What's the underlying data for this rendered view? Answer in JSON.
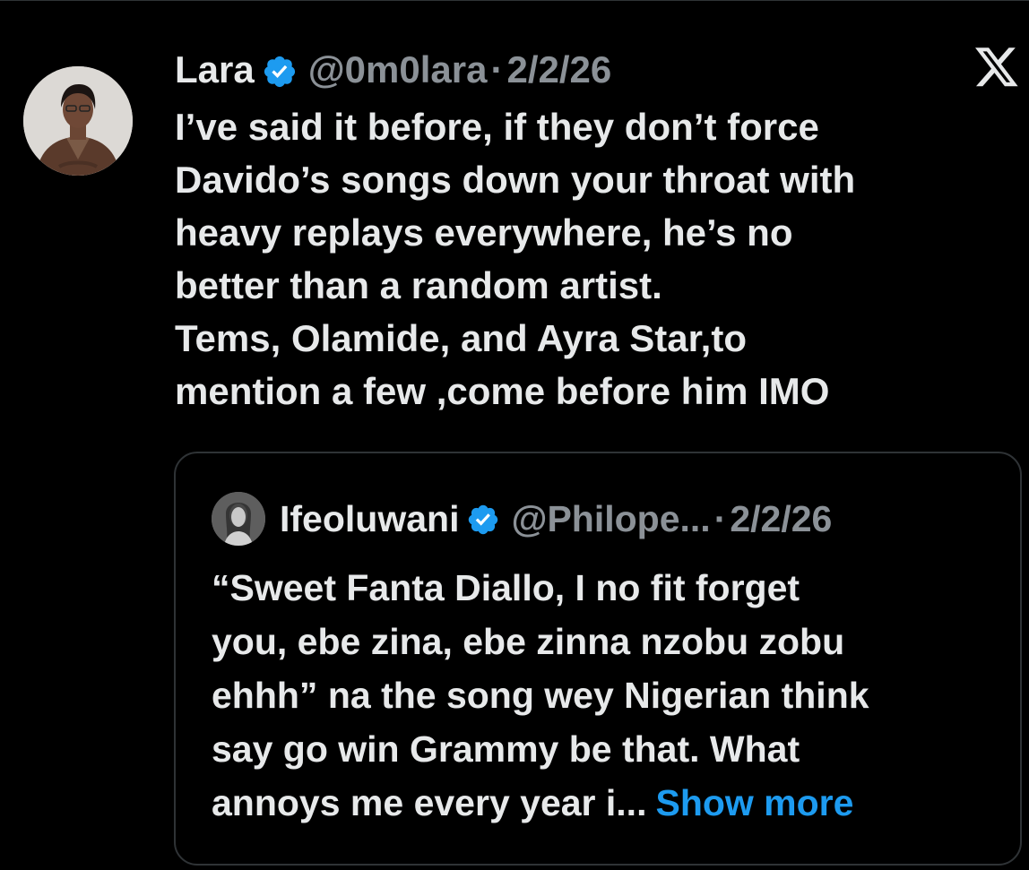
{
  "tweet": {
    "author": {
      "name": "Lara",
      "handle": "@0m0lara",
      "verified": true
    },
    "separator": "·",
    "date": "2/2/26",
    "text_lines": [
      "I’ve said it before, if they don’t force",
      "Davido’s songs down your throat with",
      "heavy replays everywhere, he’s no",
      "better than a random artist.",
      "Tems, Olamide, and Ayra Star,to",
      "mention a few ,come before him IMO"
    ]
  },
  "quoted_tweet": {
    "author": {
      "name": "Ifeoluwani",
      "handle": "@Philope...",
      "verified": true
    },
    "separator": "·",
    "date": "2/2/26",
    "text_lines": [
      "“Sweet Fanta Diallo, I no fit forget",
      "you, ebe zina, ebe zinna nzobu zobu",
      "ehhh” na the song wey Nigerian think",
      "say go win Grammy be that. What",
      "annoys me every year i..."
    ],
    "show_more_label": "Show more"
  },
  "icons": {
    "platform_logo": "x-logo-icon",
    "verified_badge": "verified-badge-icon"
  },
  "colors": {
    "background": "#000000",
    "text": "#e7e9ea",
    "secondary_text": "#8b9197",
    "link": "#1d9bf0",
    "verified": "#1d9bf0",
    "border": "#2f3336"
  }
}
